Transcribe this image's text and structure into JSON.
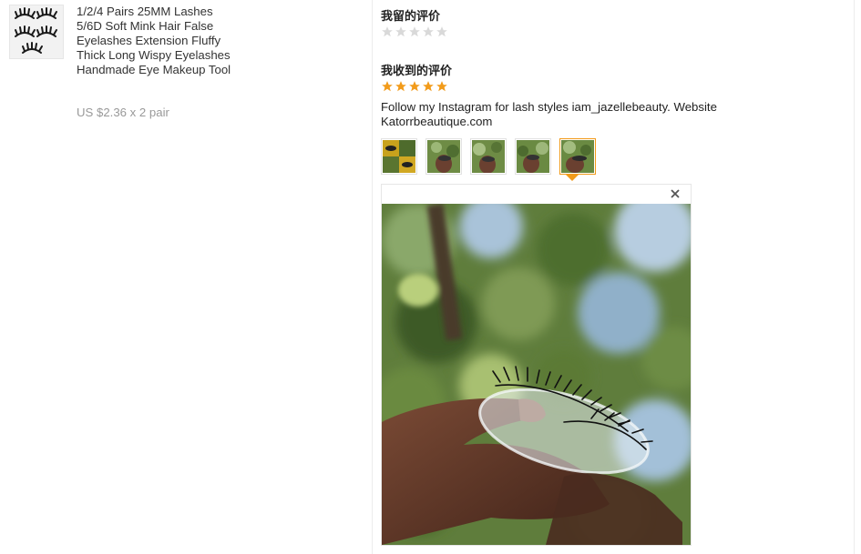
{
  "product": {
    "title": "1/2/4 Pairs 25MM Lashes 5/6D Soft Mink Hair False Eyelashes Extension Fluffy Thick Long Wispy Eyelashes Handmade Eye Makeup Tool",
    "price": "US $2.36 x 2 pair",
    "thumbnail_icon": "eyelash-product-photo"
  },
  "my_review": {
    "title": "我留的评价",
    "rating": 0,
    "max_rating": 5
  },
  "received_review": {
    "title": "我收到的评价",
    "rating": 5,
    "max_rating": 5,
    "text": "Follow my Instagram for lash styles iam_jazellebeauty. Website Katorrbeautique.com",
    "photo_count": 5,
    "active_photo": 5
  },
  "viewer": {
    "close_icon": "close-icon"
  },
  "colors": {
    "star_filled": "#f29b1a",
    "star_empty": "#d9d9d9",
    "active_border": "#f29b1a"
  }
}
